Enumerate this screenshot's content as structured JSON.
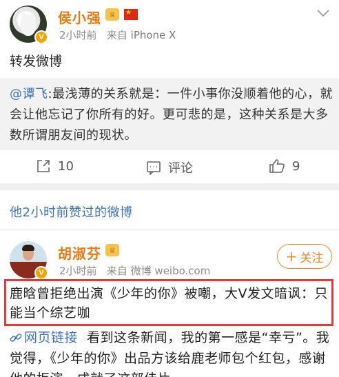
{
  "post1": {
    "author": "侯小强",
    "meta_time": "2小时前",
    "meta_from": "来自",
    "meta_device": "iPhone X",
    "text": "转发微博",
    "quote": {
      "mention": "@谭飞",
      "text": ":最浅薄的关系就是：一件小事你没顺着他的心，就会让他忘记了你所有的好。更可悲的是，这种关系是大多数所谓朋友间的现状。"
    },
    "actions": {
      "repost_count": "10",
      "comment_label": "评论",
      "like_count": "9"
    }
  },
  "liked_header": "他2小时前赞过的微博",
  "post2": {
    "author": "胡淑芬",
    "meta_time": "2小时前",
    "meta_from": "来自",
    "meta_source": "微博 weibo.com",
    "follow_label": "关注",
    "highlight_text": "鹿晗曾拒绝出演《少年的你》被嘲，大V发文暗讽：只能当个综艺咖",
    "link_label": "网页链接",
    "text": "看到这条新闻，我的第一感是“幸亏”。我觉得，《少年的你》出品方该给鹿老师包个红包，感谢他的拒演，成就了这部佳片。"
  },
  "colors": {
    "name_orange": "#e97a12",
    "link_blue": "#3d73b8",
    "highlight_red": "#e33b3b",
    "follow_orange": "#f08a2a"
  },
  "icons": [
    "chevron-down-icon",
    "repost-icon",
    "comment-icon",
    "like-icon",
    "verified-badge-icon",
    "member-crown-icon",
    "china-flag-icon",
    "link-icon",
    "plus-icon"
  ]
}
